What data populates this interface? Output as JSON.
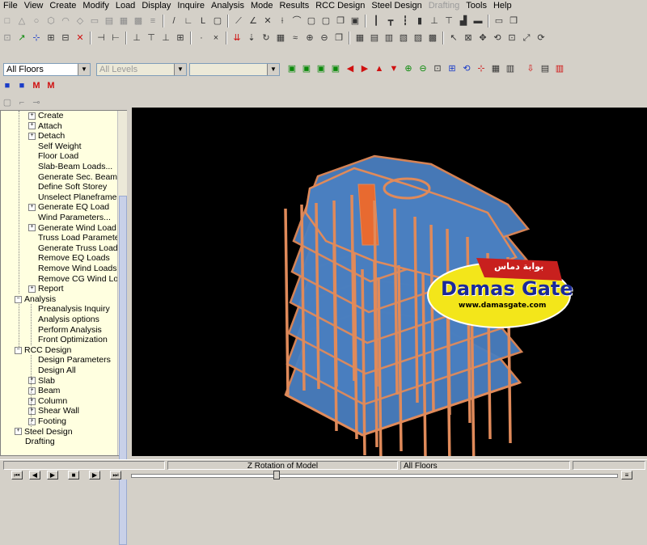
{
  "menu": [
    "File",
    "View",
    "Create",
    "Modify",
    "Load",
    "Display",
    "Inquire",
    "Analysis",
    "Mode",
    "Results",
    "RCC Design",
    "Steel Design",
    "Drafting",
    "Tools",
    "Help"
  ],
  "menu_disabled": "Drafting",
  "toolbar": {
    "floors_select": "All Floors",
    "levels_select": "All Levels",
    "third_select": ""
  },
  "tree": {
    "items": [
      {
        "label": "Create",
        "pm": "+"
      },
      {
        "label": "Attach",
        "pm": "+"
      },
      {
        "label": "Detach",
        "pm": "+"
      },
      {
        "label": "Self Weight",
        "pm": ""
      },
      {
        "label": "Floor Load",
        "pm": ""
      },
      {
        "label": "Slab-Beam Loads...",
        "pm": ""
      },
      {
        "label": "Generate Sec. Beam Loac",
        "pm": ""
      },
      {
        "label": "Define Soft Storey",
        "pm": ""
      },
      {
        "label": "Unselect Planeframe for E",
        "pm": ""
      },
      {
        "label": "Generate EQ Load",
        "pm": "+"
      },
      {
        "label": "Wind Parameters...",
        "pm": ""
      },
      {
        "label": "Generate Wind Load",
        "pm": "+"
      },
      {
        "label": "Truss Load Parameters",
        "pm": ""
      },
      {
        "label": "Generate Truss Load",
        "pm": ""
      },
      {
        "label": "Remove EQ Loads",
        "pm": ""
      },
      {
        "label": "Remove Wind Loads",
        "pm": ""
      },
      {
        "label": "Remove CG Wind Load",
        "pm": ""
      },
      {
        "label": "Report",
        "pm": "+"
      }
    ],
    "analysis": {
      "label": "Analysis",
      "items": [
        "Preanalysis Inquiry",
        "Analysis options",
        "Perform Analysis",
        "Front Optimization"
      ]
    },
    "rcc": {
      "label": "RCC Design",
      "items": [
        {
          "label": "Design Parameters",
          "pm": ""
        },
        {
          "label": "Design All",
          "pm": ""
        },
        {
          "label": "Slab",
          "pm": "+"
        },
        {
          "label": "Beam",
          "pm": "+"
        },
        {
          "label": "Column",
          "pm": "+"
        },
        {
          "label": "Shear Wall",
          "pm": "+"
        },
        {
          "label": "Footing",
          "pm": "+"
        }
      ]
    },
    "steel": "Steel Design",
    "drafting": "Drafting"
  },
  "watermark": {
    "arabic": "بوابة دماس",
    "title": "Damas Gate",
    "url": "www.damasgate.com"
  },
  "status": {
    "mode": "Z Rotation of Model",
    "floors": "All Floors"
  },
  "colors": {
    "slab": "#4a7fc0",
    "column": "#e08a5a",
    "viewport": "#000000",
    "tree_bg": "#ffffe0"
  }
}
